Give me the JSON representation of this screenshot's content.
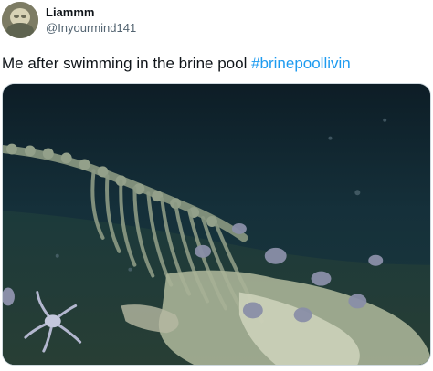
{
  "tweet": {
    "display_name": "Liammm",
    "handle": "@Inyourmind141",
    "text_main": "Me after swimming in the brine pool ",
    "hashtag": "#brinepoollivin",
    "avatar_icon": "avatar-photo",
    "media_icon": "whale-skeleton-photo"
  },
  "colors": {
    "text": "#0f1419",
    "secondary": "#536471",
    "link": "#1d9bf0"
  }
}
